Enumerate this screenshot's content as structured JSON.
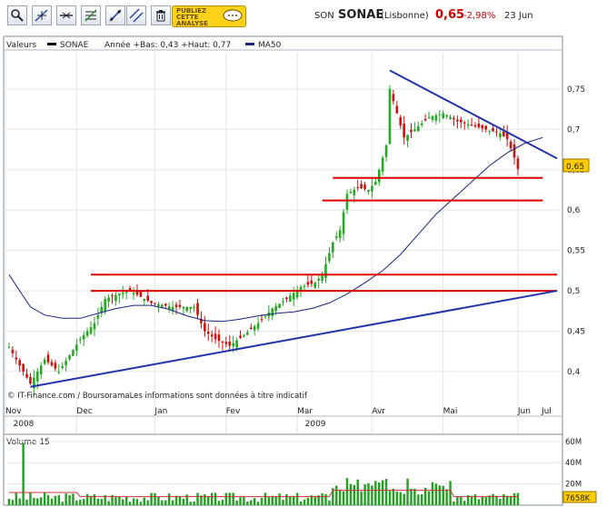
{
  "toolbar": {
    "buttons": [
      "zoom-icon",
      "crosshair-cursor-icon",
      "trendline-icon",
      "horizontal-line-icon",
      "fibonacci-icon",
      "channel-icon",
      "parallel-line-icon",
      "trash-icon"
    ],
    "ad_line1": "PUBLIEZ",
    "ad_line2": "CETTE",
    "ad_line3": "ANALYSE"
  },
  "quote": {
    "ticker": "SON",
    "name": "SONAE",
    "market": "(Lisbonne)",
    "price": "0,65",
    "change": "-2,98%",
    "date": "23 Jun"
  },
  "legend": {
    "values_label": "Valeurs",
    "series_label": "SONAE",
    "stats": "Année +Bas: 0,43 +Haut: 0,77",
    "ma_label": "MA50"
  },
  "price_tag": "0,65",
  "copyright": "© IT-Finance.com / BoursoramaLes informations sont données à titre indicatif",
  "volume_label": "Volume 15",
  "volume_tag": "7658K",
  "colors": {
    "up": "#22aa22",
    "down": "#cc1111",
    "ma": "#1a237e",
    "trend": "#2233aa",
    "support": "#dd0000",
    "volume": "#1fa01f"
  },
  "chart_data": {
    "type": "candlestick",
    "title": "SONAE",
    "y_ticks": [
      "0,4",
      "0,45",
      "0,5",
      "0,55",
      "0,6",
      "0,65",
      "0,7",
      "0,75"
    ],
    "y_range": [
      0.365,
      0.795
    ],
    "x_ticks": [
      "Nov",
      "Dec",
      "Jan",
      "Fev",
      "Mar",
      "Avr",
      "Mai",
      "Jun",
      "Jul"
    ],
    "year_labels": [
      {
        "label": "2008",
        "under": "Nov"
      },
      {
        "label": "2009",
        "under": "Mar"
      }
    ],
    "volume_ticks": [
      "60M",
      "40M",
      "20M"
    ],
    "volume_range": [
      0,
      65
    ],
    "closes_monthly": [
      {
        "month": "Nov",
        "approx_close": 0.4
      },
      {
        "month": "Dec",
        "approx_close": 0.46
      },
      {
        "month": "Jan",
        "approx_close": 0.48
      },
      {
        "month": "Fev",
        "approx_close": 0.44
      },
      {
        "month": "Mar",
        "approx_close": 0.52
      },
      {
        "month": "Avr",
        "approx_close": 0.68
      },
      {
        "month": "Mai",
        "approx_close": 0.71
      },
      {
        "month": "Jun",
        "approx_close": 0.65
      }
    ],
    "ma50_points": [
      [
        0,
        0.52
      ],
      [
        3,
        0.5
      ],
      [
        6,
        0.48
      ],
      [
        10,
        0.47
      ],
      [
        15,
        0.466
      ],
      [
        20,
        0.466
      ],
      [
        25,
        0.472
      ],
      [
        30,
        0.478
      ],
      [
        35,
        0.482
      ],
      [
        40,
        0.482
      ],
      [
        45,
        0.477
      ],
      [
        50,
        0.469
      ],
      [
        55,
        0.463
      ],
      [
        60,
        0.462
      ],
      [
        65,
        0.465
      ],
      [
        70,
        0.469
      ],
      [
        75,
        0.472
      ],
      [
        80,
        0.474
      ],
      [
        85,
        0.478
      ],
      [
        90,
        0.485
      ],
      [
        95,
        0.496
      ],
      [
        100,
        0.51
      ],
      [
        105,
        0.525
      ],
      [
        110,
        0.545
      ],
      [
        115,
        0.57
      ],
      [
        120,
        0.595
      ],
      [
        125,
        0.615
      ],
      [
        130,
        0.635
      ],
      [
        135,
        0.655
      ],
      [
        140,
        0.671
      ],
      [
        145,
        0.683
      ],
      [
        150,
        0.69
      ]
    ],
    "trendlines": [
      {
        "name": "support-trend",
        "from": [
          6,
          0.381
        ],
        "to": [
          154,
          0.5
        ]
      },
      {
        "name": "resistance-trend",
        "from": [
          107,
          0.773
        ],
        "to": [
          154,
          0.664
        ]
      }
    ],
    "horizontal_lines": [
      {
        "level": 0.52,
        "from": 23,
        "to": 154
      },
      {
        "level": 0.5,
        "from": 23,
        "to": 154
      },
      {
        "level": 0.612,
        "from": 88,
        "to": 150
      },
      {
        "level": 0.64,
        "from": 91,
        "to": 150
      }
    ],
    "last_price": 0.65
  }
}
